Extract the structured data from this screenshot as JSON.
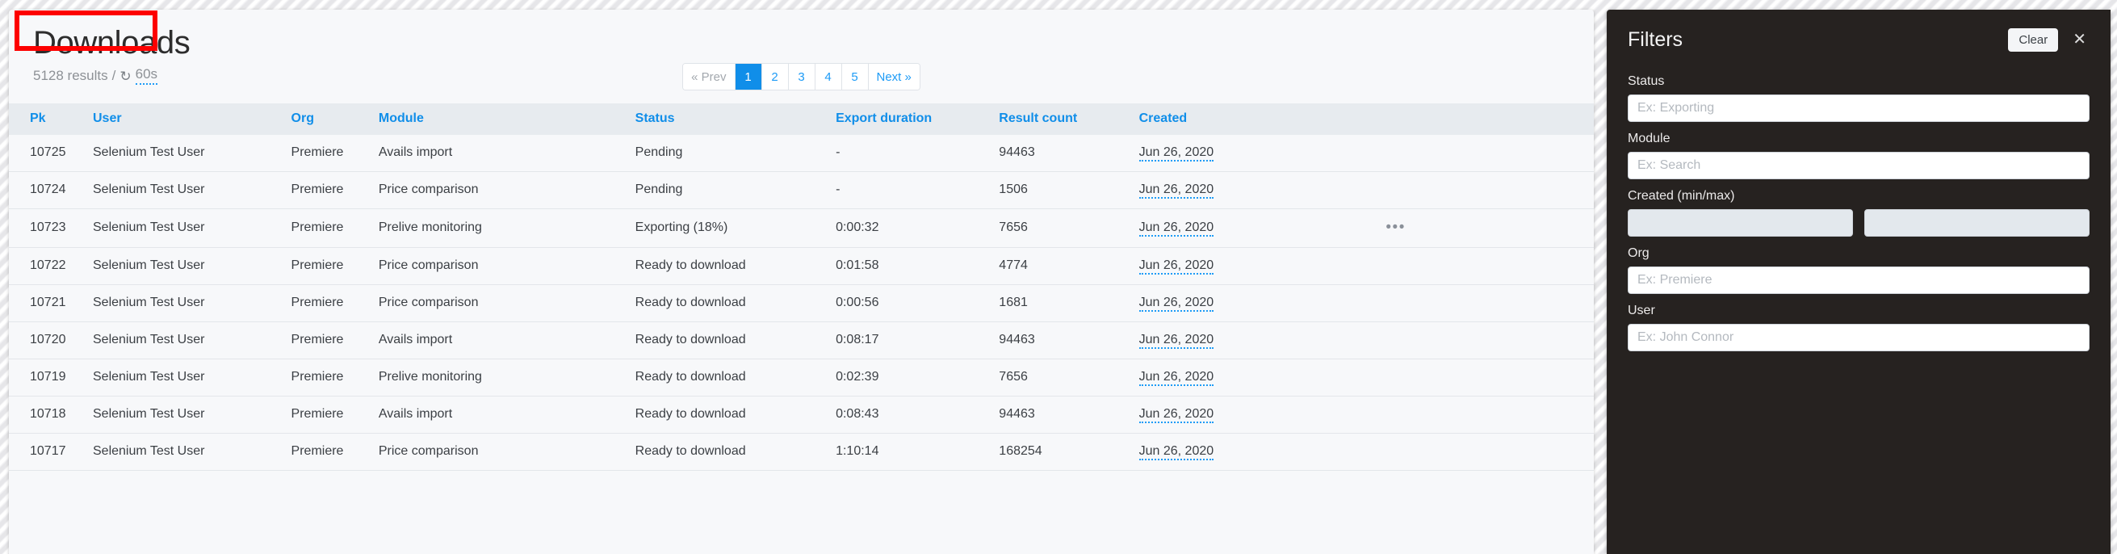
{
  "page": {
    "title": "Downloads",
    "results_count": "5128 results",
    "separator": "/",
    "refresh_icon": "refresh-icon",
    "refresh_interval": "60s"
  },
  "pagination": {
    "prev_label": "« Prev",
    "next_label": "Next »",
    "pages": [
      "1",
      "2",
      "3",
      "4",
      "5"
    ],
    "active_page": "1",
    "active_color": "#108ee9"
  },
  "table": {
    "columns": [
      "Pk",
      "User",
      "Org",
      "Module",
      "Status",
      "Export duration",
      "Result count",
      "Created"
    ],
    "header_color": "#108ee9",
    "rows": [
      {
        "pk": "10725",
        "user": "Selenium Test User",
        "org": "Premiere",
        "module": "Avails import",
        "status": "Pending",
        "export_duration": "-",
        "result_count": "94463",
        "created": "Jun 26, 2020",
        "menu": ""
      },
      {
        "pk": "10724",
        "user": "Selenium Test User",
        "org": "Premiere",
        "module": "Price comparison",
        "status": "Pending",
        "export_duration": "-",
        "result_count": "1506",
        "created": "Jun 26, 2020",
        "menu": ""
      },
      {
        "pk": "10723",
        "user": "Selenium Test User",
        "org": "Premiere",
        "module": "Prelive monitoring",
        "status": "Exporting (18%)",
        "export_duration": "0:00:32",
        "result_count": "7656",
        "created": "Jun 26, 2020",
        "menu": "•••"
      },
      {
        "pk": "10722",
        "user": "Selenium Test User",
        "org": "Premiere",
        "module": "Price comparison",
        "status": "Ready to download",
        "export_duration": "0:01:58",
        "result_count": "4774",
        "created": "Jun 26, 2020",
        "menu": ""
      },
      {
        "pk": "10721",
        "user": "Selenium Test User",
        "org": "Premiere",
        "module": "Price comparison",
        "status": "Ready to download",
        "export_duration": "0:00:56",
        "result_count": "1681",
        "created": "Jun 26, 2020",
        "menu": ""
      },
      {
        "pk": "10720",
        "user": "Selenium Test User",
        "org": "Premiere",
        "module": "Avails import",
        "status": "Ready to download",
        "export_duration": "0:08:17",
        "result_count": "94463",
        "created": "Jun 26, 2020",
        "menu": ""
      },
      {
        "pk": "10719",
        "user": "Selenium Test User",
        "org": "Premiere",
        "module": "Prelive monitoring",
        "status": "Ready to download",
        "export_duration": "0:02:39",
        "result_count": "7656",
        "created": "Jun 26, 2020",
        "menu": ""
      },
      {
        "pk": "10718",
        "user": "Selenium Test User",
        "org": "Premiere",
        "module": "Avails import",
        "status": "Ready to download",
        "export_duration": "0:08:43",
        "result_count": "94463",
        "created": "Jun 26, 2020",
        "menu": ""
      },
      {
        "pk": "10717",
        "user": "Selenium Test User",
        "org": "Premiere",
        "module": "Price comparison",
        "status": "Ready to download",
        "export_duration": "1:10:14",
        "result_count": "168254",
        "created": "Jun 26, 2020",
        "menu": ""
      }
    ]
  },
  "filters": {
    "title": "Filters",
    "clear_label": "Clear",
    "close_icon": "close-icon",
    "background_color": "#262220",
    "fields": {
      "status": {
        "label": "Status",
        "value": "",
        "placeholder": "Ex: Exporting"
      },
      "module": {
        "label": "Module",
        "value": "",
        "placeholder": "Ex: Search"
      },
      "created": {
        "label": "Created (min/max)",
        "min_value": "",
        "min_placeholder": "",
        "max_value": "",
        "max_placeholder": ""
      },
      "org": {
        "label": "Org",
        "value": "",
        "placeholder": "Ex: Premiere"
      },
      "user": {
        "label": "User",
        "value": "",
        "placeholder": "Ex: John Connor"
      }
    }
  },
  "annotation": {
    "color": "#fd0000",
    "target": "page-title"
  }
}
